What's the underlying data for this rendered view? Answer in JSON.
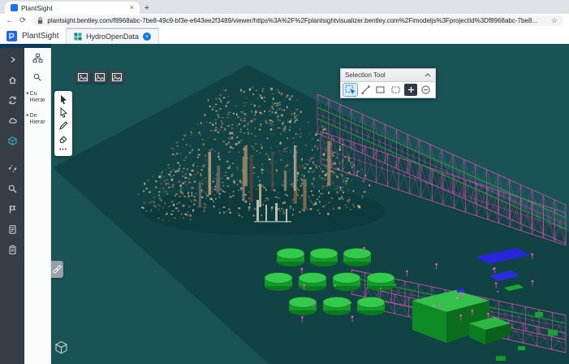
{
  "browser": {
    "tab_title": "PlantSight",
    "close_tab": "×",
    "new_tab": "+",
    "back": "←",
    "refresh": "⟳",
    "url": "plantsight.bentley.com/f8968abc-7be8-49c9-bf3e-e643ee2f3489/viewer/https%3A%2F%2Fplantsightvisualizer.bentley.com%2Fimodeljs%3FprojectId%3Df8968abc-7be8...",
    "bookmark_star": "☆"
  },
  "app": {
    "brand": "PlantSight",
    "document_tab": "HydroOpenData",
    "document_tab_close": "×"
  },
  "nav_rail": {
    "icons": [
      "expand-chevron",
      "home",
      "sync",
      "cloud",
      "model-cube",
      "broken-link",
      "search",
      "flag",
      "document",
      "report"
    ]
  },
  "tree_panel": {
    "icons": [
      "hierarchy",
      "search"
    ],
    "items": [
      {
        "label": "Cu Hierar"
      },
      {
        "label": "De Hierar"
      }
    ]
  },
  "viewer": {
    "saved_view_buttons": 3,
    "tool_palette": {
      "tools": [
        "select",
        "fence-select",
        "measure",
        "erase"
      ],
      "more": "•••"
    },
    "selection_panel": {
      "title": "Selection Tool",
      "tools": [
        "pick-select",
        "line-select",
        "box-select",
        "fence-select",
        "add-select",
        "remove-select"
      ],
      "active_tool": "pick-select"
    },
    "palette": {
      "background": "#1a5356",
      "ground": "#114345",
      "point_cloud": "#a88a64",
      "piping": "#d24fae",
      "tanks": "#2fc94a",
      "equipment_blue": "#2b2be0"
    }
  },
  "colors": {
    "accent_blue": "#1a73e8",
    "brand_blue": "#2662f0",
    "rail_bg": "#363d45",
    "navy_bar": "#0c3a5f"
  }
}
